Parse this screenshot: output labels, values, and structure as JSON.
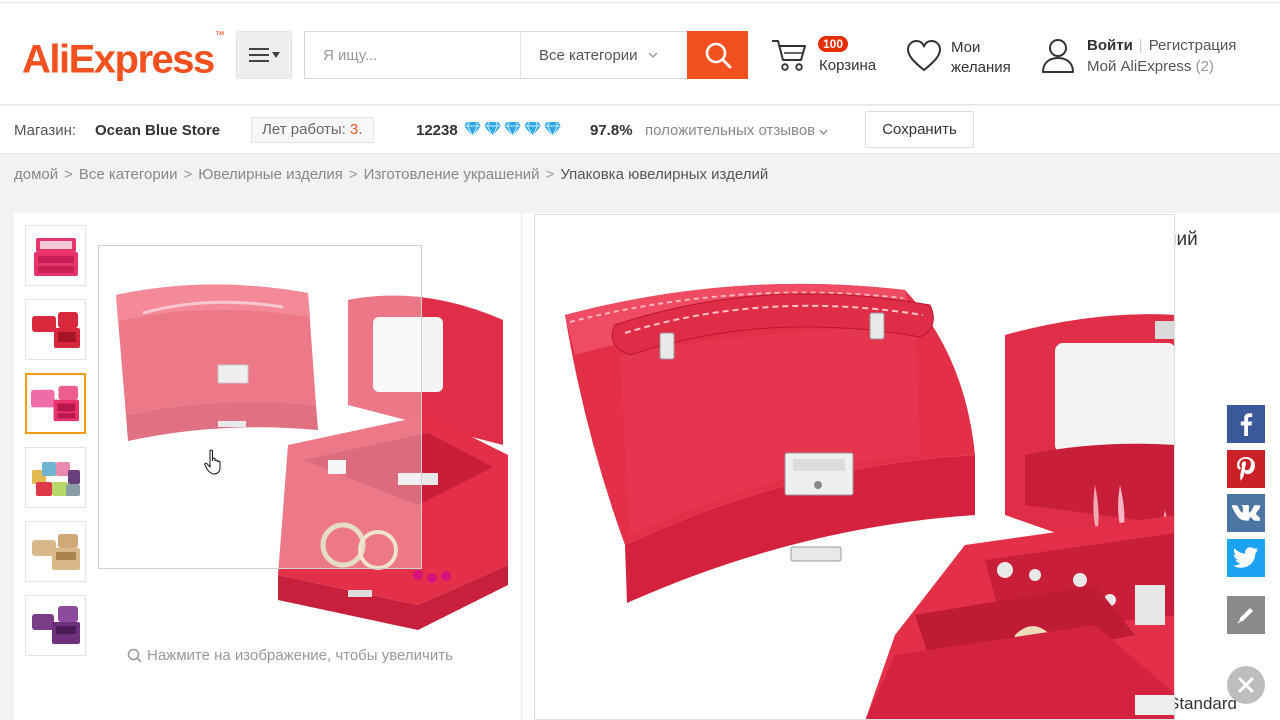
{
  "header": {
    "logo": "AliExpress",
    "logo_tm": "™",
    "search_placeholder": "Я ищу...",
    "category": "Все категории",
    "cart_count": "100",
    "cart_label": "Корзина",
    "wishlist_label": "Мои желания",
    "login": "Войти",
    "register": "Регистрация",
    "my_account": "Мой AliExpress",
    "my_account_count": "(2)"
  },
  "store": {
    "label": "Магазин:",
    "name": "Ocean Blue Store",
    "years_label": "Лет работы:",
    "years_value": "3",
    "years_suffix": ".",
    "score": "12238",
    "diamonds": 5,
    "positive_percent": "97.8%",
    "positive_label": "положительных отзывов",
    "save_label": "Сохранить"
  },
  "breadcrumb": {
    "items": [
      "домой",
      "Все категории",
      "Ювелирные изделия",
      "Изготовление украшений",
      "Упаковка ювелирных изделий"
    ],
    "separator": ">"
  },
  "gallery": {
    "zoom_hint": "Нажмите на изображение, чтобы увеличить",
    "thumbnail_colors": [
      "#e8336b",
      "#d8283c",
      "#f06ca8",
      "#7fb7c9",
      "#d9b98a",
      "#7a3d88"
    ],
    "active_index": 2
  },
  "info": {
    "title_fragment": "ний",
    "shipping_fragment": "Standard"
  },
  "colors": {
    "brand": "#f3501f",
    "box_red": "#e33048",
    "facebook": "#3b5998",
    "pinterest": "#cb2027",
    "vk": "#4c75a3",
    "twitter": "#1da1f2"
  }
}
